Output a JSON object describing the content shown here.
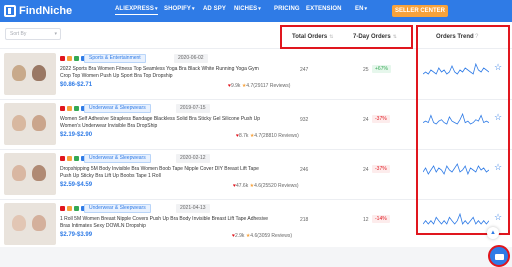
{
  "brand": {
    "name": "FindNiche",
    "logo_icon": "findniche-logo-icon"
  },
  "nav": {
    "items": [
      {
        "label": "ALIEXPRESS",
        "active": true,
        "caret": "▾"
      },
      {
        "label": "SHOPIFY",
        "caret": "▾"
      },
      {
        "label": "AD SPY"
      },
      {
        "label": "NICHES",
        "caret": "▾"
      },
      {
        "label": "PRICING"
      },
      {
        "label": "EXTENSION"
      },
      {
        "label": "EN",
        "caret": "▾"
      }
    ],
    "seller_center": "SELLER CENTER"
  },
  "toolbar": {
    "sort_placeholder": "Sort By"
  },
  "columns": {
    "total": "Total Orders",
    "seven_day": "7-Day Orders",
    "trend": "Orders Trend",
    "sort_indicator": "⇅",
    "help_icon": "?"
  },
  "colors": {
    "accent": "#2f7be6",
    "highlight": "#e0161e",
    "up": "#34a853",
    "down": "#e0161e"
  },
  "products": [
    {
      "category": "Sports & Entertainment",
      "date": "2020-06-02",
      "title": "2022 Sports Bra Women Fitness Top Seamless Yoga Bra Black White Running Yoga Gym Crop Top Women Push Up Sport Bra Top Dropship",
      "price": "$0.86-$2.71",
      "likes": "9.9k",
      "rating": "4.7(29117 Reviews)",
      "total_orders": "247",
      "seven_day_orders": "25",
      "change": "+67%",
      "change_dir": "up",
      "trend": [
        3,
        4,
        3,
        5,
        4,
        3,
        6,
        4,
        5,
        3,
        4,
        7,
        4,
        3,
        5,
        4,
        6,
        5,
        4,
        3,
        8,
        5,
        4,
        6,
        5,
        4
      ]
    },
    {
      "category": "Underwear & Sleepwears",
      "date": "2019-07-15",
      "title": "Women Self Adhesive Strapless Bandage Blackless Solid Bra Sticky Gel Silicone Push Up Women's Underwear Invisible Bra DropShip",
      "price": "$2.19-$2.90",
      "likes": "8.7k",
      "rating": "4.7(28810 Reviews)",
      "total_orders": "932",
      "seven_day_orders": "24",
      "change": "-37%",
      "change_dir": "down",
      "trend": [
        4,
        5,
        4,
        9,
        4,
        3,
        5,
        6,
        4,
        3,
        8,
        5,
        4,
        3,
        6,
        10,
        4,
        5,
        3,
        4,
        6,
        5,
        9,
        4,
        5,
        4
      ]
    },
    {
      "category": "Underwear & Sleepwears",
      "date": "2020-02-12",
      "title": "Dropshipping 5M Body Invisible Bra Women Boob Tape Nipple Cover DIY Breast Lift Tape Push Up Sticky Bra Lift Up Boobs Tape 1 Roll",
      "price": "$2.59-$4.59",
      "likes": "47.6k",
      "rating": "4.6(25520 Reviews)",
      "total_orders": "246",
      "seven_day_orders": "24",
      "change": "-37%",
      "change_dir": "down",
      "trend": [
        5,
        7,
        4,
        6,
        8,
        5,
        7,
        6,
        4,
        8,
        6,
        5,
        7,
        9,
        5,
        6,
        8,
        4,
        7,
        6,
        5,
        8,
        6,
        7,
        5,
        6
      ]
    },
    {
      "category": "Underwear & Sleepwears",
      "date": "2021-04-13",
      "title": "1 Roll 5M Women Breast Nipple Covers Push Up Bra Body Invisible Breast Lift Tape Adhesive Bras Intimates Sexy DOWLN Dropship",
      "price": "$2.79-$3.99",
      "likes": "2.9k",
      "rating": "4.6(3059 Reviews)",
      "total_orders": "218",
      "seven_day_orders": "12",
      "change": "-14%",
      "change_dir": "down",
      "trend": [
        3,
        4,
        3,
        4,
        3,
        5,
        4,
        3,
        4,
        3,
        5,
        4,
        3,
        4,
        6,
        3,
        4,
        3,
        4,
        5,
        3,
        4,
        3,
        4,
        3,
        4
      ]
    }
  ]
}
